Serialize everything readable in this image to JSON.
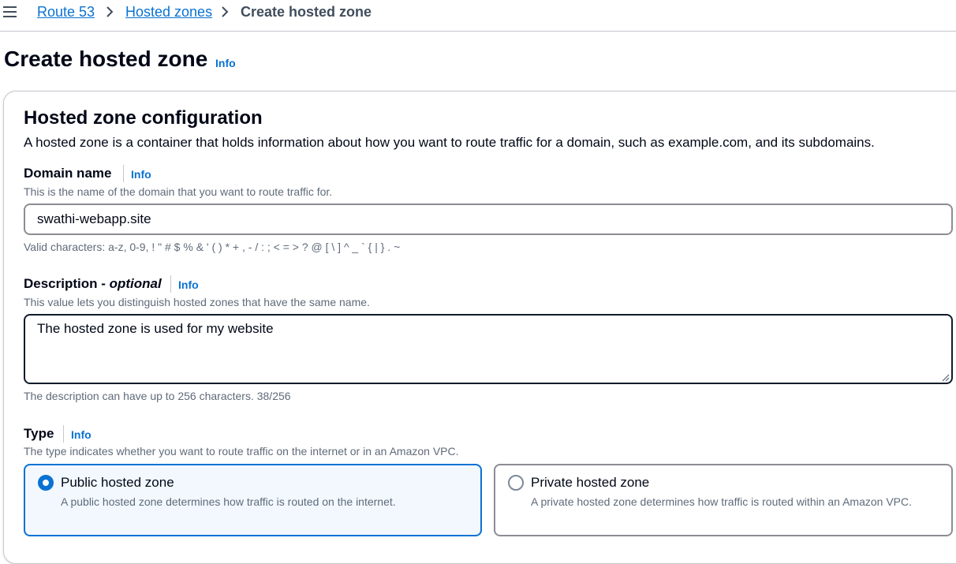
{
  "breadcrumb": {
    "items": [
      "Route 53",
      "Hosted zones",
      "Create hosted zone"
    ]
  },
  "page": {
    "title": "Create hosted zone",
    "info": "Info"
  },
  "config": {
    "title": "Hosted zone configuration",
    "description": "A hosted zone is a container that holds information about how you want to route traffic for a domain, such as example.com, and its subdomains."
  },
  "domain_name": {
    "label": "Domain name",
    "info": "Info",
    "description": "This is the name of the domain that you want to route traffic for.",
    "value": "swathi-webapp.site",
    "constraint": "Valid characters: a-z, 0-9, ! \" # $ % & ' ( ) * + , - / : ; < = > ? @ [ \\ ] ^ _ ` { | } . ~"
  },
  "description_field": {
    "label": "Description - ",
    "label_optional": "optional",
    "info": "Info",
    "description": "This value lets you distinguish hosted zones that have the same name.",
    "value": "The hosted zone is used for my website",
    "constraint": "The description can have up to 256 characters. 38/256"
  },
  "type": {
    "label": "Type",
    "info": "Info",
    "description": "The type indicates whether you want to route traffic on the internet or in an Amazon VPC.",
    "options": [
      {
        "title": "Public hosted zone",
        "description": "A public hosted zone determines how traffic is routed on the internet.",
        "selected": true
      },
      {
        "title": "Private hosted zone",
        "description": "A private hosted zone determines how traffic is routed within an Amazon VPC.",
        "selected": false
      }
    ]
  },
  "colors": {
    "link": "#0972d3",
    "selected_bg": "#f2f8fd",
    "text": "#000716",
    "muted": "#5f6b7a"
  }
}
